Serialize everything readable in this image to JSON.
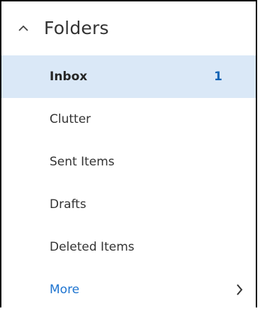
{
  "header": {
    "title": "Folders",
    "icon": "chevron-up-icon"
  },
  "folders": [
    {
      "label": "Inbox",
      "count": "1",
      "selected": true
    },
    {
      "label": "Clutter",
      "count": ""
    },
    {
      "label": "Sent Items",
      "count": ""
    },
    {
      "label": "Drafts",
      "count": ""
    },
    {
      "label": "Deleted Items",
      "count": ""
    }
  ],
  "more": {
    "label": "More",
    "icon": "chevron-right-icon"
  },
  "colors": {
    "selected_background": "#dae8f7",
    "count_text": "#0f63b5",
    "link_text": "#1e74d0",
    "border": "#000000"
  }
}
